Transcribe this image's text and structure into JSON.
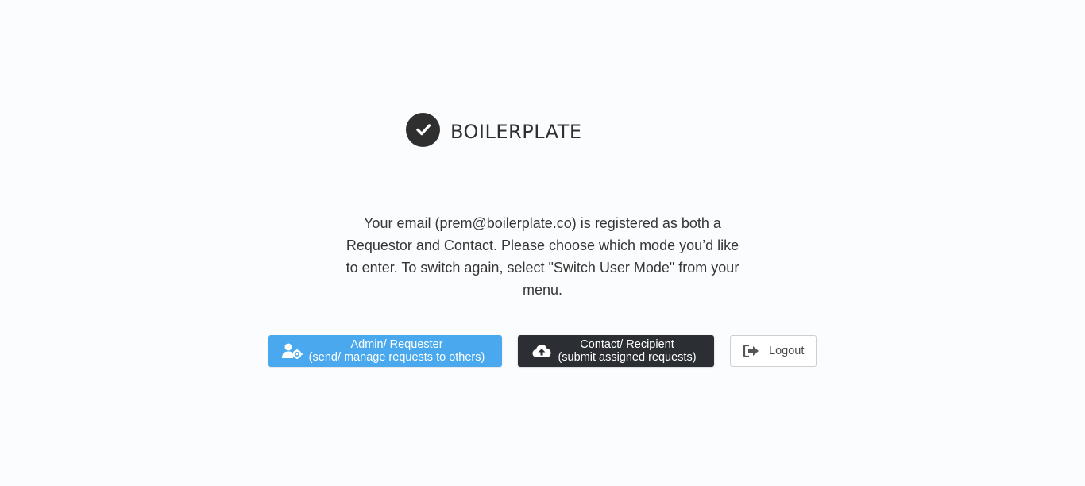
{
  "brand": {
    "name": "Boilerplate"
  },
  "message": "Your email (prem@boilerplate.co) is registered as both a Requestor and Contact. Please choose which mode you’d like to enter. To switch again, select \"Switch User Mode\" from your menu.",
  "buttons": {
    "admin": {
      "line1": "Admin/ Requester",
      "line2": "(send/ manage requests to others)",
      "icon": "user-cog-icon",
      "color": "#4aa9ee"
    },
    "contact": {
      "line1": "Contact/ Recipient",
      "line2": "(submit assigned requests)",
      "icon": "cloud-upload-icon",
      "color": "#2b2e33"
    },
    "logout": {
      "label": "Logout",
      "icon": "sign-out-icon"
    }
  }
}
